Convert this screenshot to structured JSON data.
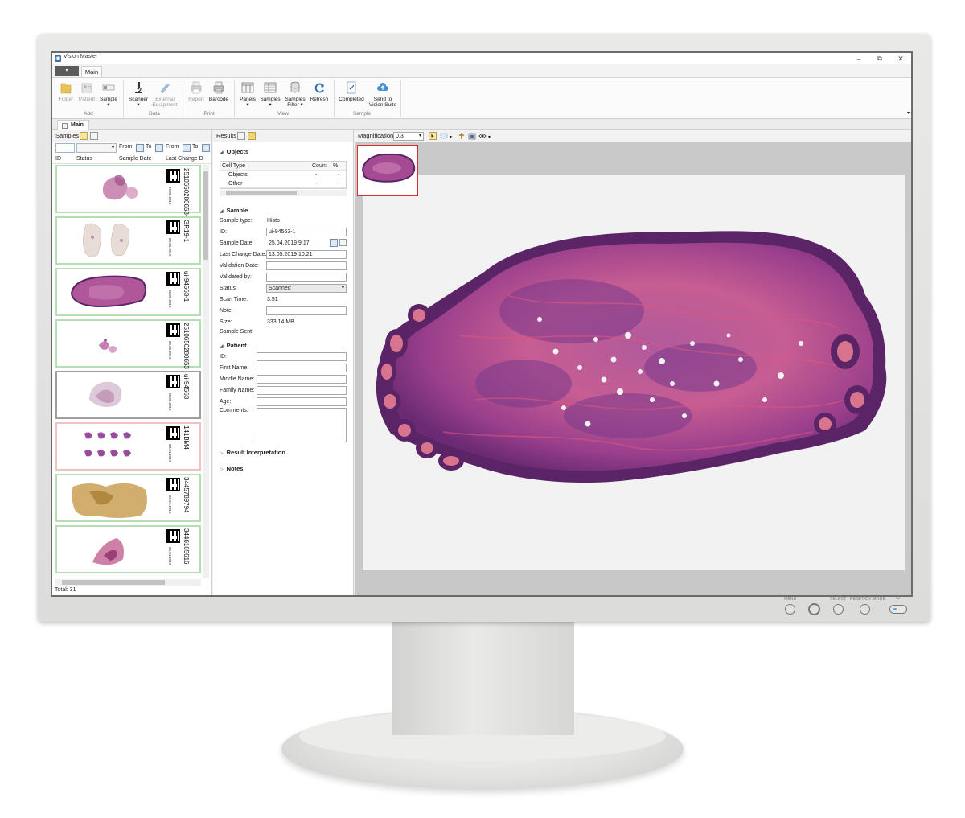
{
  "window": {
    "title": "Vision Master",
    "minimize": "–",
    "restore": "⧉",
    "close": "✕"
  },
  "ribbon": {
    "file_tab": "",
    "main_tab": "Main",
    "buttons": {
      "folder": "Folder",
      "patient": "Patient",
      "sample": "Sample",
      "scanner": "Scanner",
      "external_1": "External",
      "external_2": "Equipment",
      "report": "Report",
      "barcode": "Barcode",
      "panels": "Panels",
      "samples": "Samples",
      "samples_filter_1": "Samples",
      "samples_filter_2": "Filter ▾",
      "refresh": "Refresh",
      "completed": "Completed",
      "send_1": "Send to",
      "send_2": "Vision Suite"
    },
    "groups": {
      "add": "Add",
      "data": "Data",
      "print": "Print",
      "view": "View",
      "sample": "Sample"
    }
  },
  "doc_tab": "Main",
  "samples_panel": {
    "title": "Samples",
    "filter_from": "From",
    "filter_to": "To",
    "filter_from2": "From",
    "filter_to2": "To",
    "columns": [
      "ID",
      "Status",
      "Sample Date",
      "Last Change D"
    ],
    "items": [
      {
        "id": "2510650280653-",
        "date": "29.05.2019",
        "state": "green"
      },
      {
        "id": "GR19-1",
        "date": "29.05.2019",
        "state": "green"
      },
      {
        "id": "ui-94563-1",
        "date": "25.05.2019",
        "state": "green"
      },
      {
        "id": "2510650280653",
        "date": "29.05.2019",
        "state": "green"
      },
      {
        "id": "ui-94563",
        "date": "25.05.2019",
        "state": "selected"
      },
      {
        "id": "141BM4",
        "date": "30.04.2019",
        "state": "red"
      },
      {
        "id": "3445789794",
        "date": "30.04.2019",
        "state": "green"
      },
      {
        "id": "3446165616",
        "date": "26.04.2019",
        "state": "green"
      }
    ],
    "total": "Total: 31"
  },
  "results_panel": {
    "title": "Results",
    "objects": {
      "title": "Objects",
      "headers": [
        "Cell Type",
        "Count",
        "%"
      ],
      "rows": [
        {
          "type": "Objects",
          "count": "-",
          "pct": "-"
        },
        {
          "type": "Other",
          "count": "-",
          "pct": "-"
        }
      ]
    },
    "sample": {
      "title": "Sample",
      "fields": {
        "sample_type_label": "Sample type:",
        "sample_type": "Histo",
        "id_label": "ID:",
        "id": "ui-94563-1",
        "sample_date_label": "Sample Date:",
        "sample_date": "25.04.2019 9:17",
        "last_change_label": "Last Change Date:",
        "last_change": "13.05.2019 10:21",
        "validation_date_label": "Validation Date:",
        "validated_by_label": "Validated by:",
        "status_label": "Status:",
        "status": "Scanned",
        "scan_time_label": "Scan Time:",
        "scan_time": "3:51",
        "note_label": "Note:",
        "size_label": "Size:",
        "size": "333,14 MB",
        "sample_sent_label": "Sample Sent:"
      }
    },
    "patient": {
      "title": "Patient",
      "labels": [
        "ID:",
        "First Name:",
        "Middle Name:",
        "Family Name:",
        "Age:",
        "Comments:"
      ]
    },
    "result_interpretation": "Result Interpretation",
    "notes": "Notes"
  },
  "viewer": {
    "magnification_label": "Magnification",
    "magnification": "0,3"
  },
  "colors": {
    "tissue_dark": "#5a2466",
    "tissue_mid": "#9a3f8c",
    "tissue_pink": "#d45a8e",
    "selection_red": "#d23232",
    "row_green": "#b4deb4"
  }
}
